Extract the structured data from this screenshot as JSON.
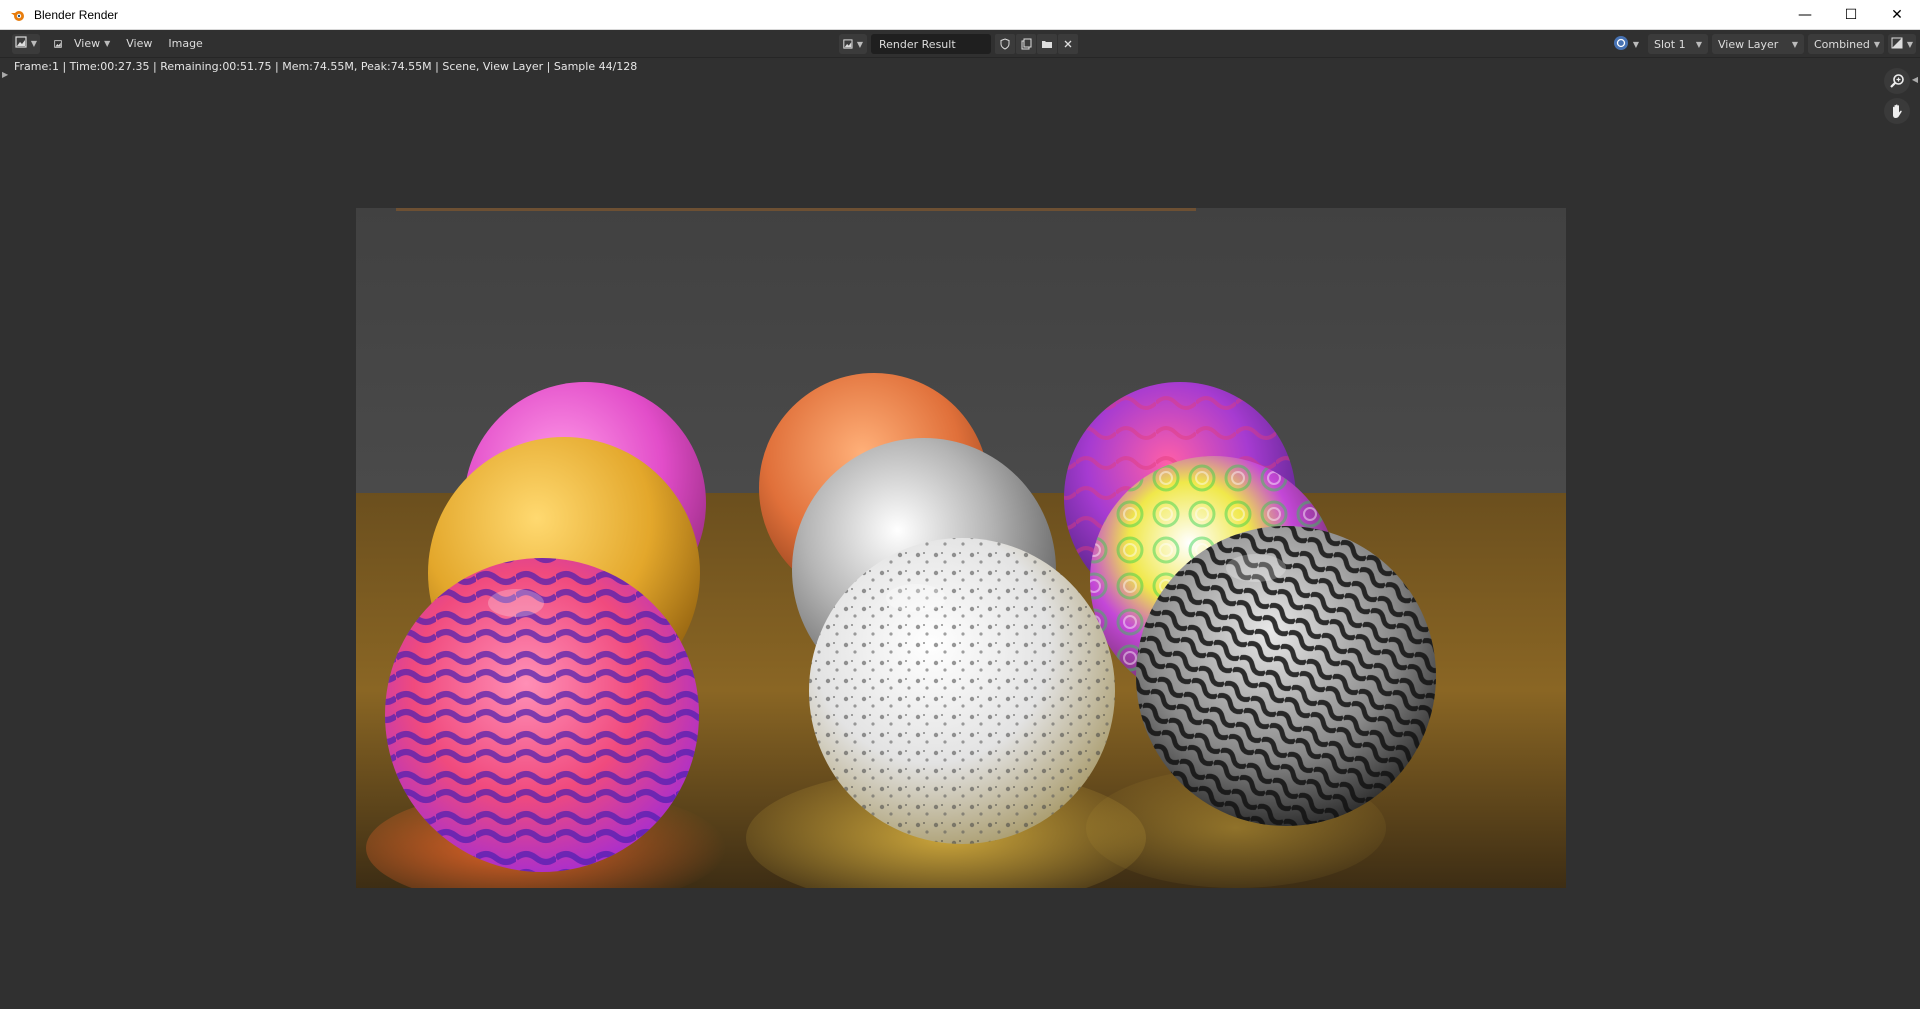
{
  "window": {
    "title": "Blender Render",
    "minimize": "—",
    "maximize": "☐",
    "close": "✕"
  },
  "header": {
    "menus": [
      "View",
      "View",
      "Image"
    ],
    "image_name": "Render Result",
    "slot": "Slot 1",
    "view_layer": "View Layer",
    "pass": "Combined"
  },
  "status": {
    "text": "Frame:1 | Time:00:27.35 | Remaining:00:51.75 | Mem:74.55M, Peak:74.55M | Scene, View Layer | Sample 44/128"
  },
  "icons": {
    "editor_type": "image-editor-icon",
    "zoom": "zoom-icon",
    "pan": "hand-icon"
  },
  "colors": {
    "background": "#303030",
    "accent_blue": "#4772b3"
  }
}
